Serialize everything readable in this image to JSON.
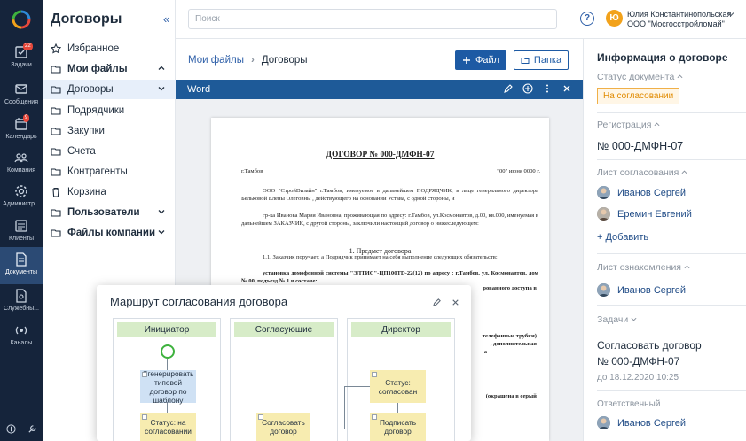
{
  "rail": {
    "items": [
      {
        "label": "Задачи",
        "icon": "tasks-icon",
        "badge": "22"
      },
      {
        "label": "Сообщения",
        "icon": "messages-icon",
        "badge": ""
      },
      {
        "label": "Календарь",
        "icon": "calendar-icon",
        "badge": "9"
      },
      {
        "label": "Компания",
        "icon": "company-icon",
        "badge": ""
      },
      {
        "label": "Администр...",
        "icon": "admin-gear-icon",
        "badge": ""
      },
      {
        "label": "Клиенты",
        "icon": "clients-icon",
        "badge": ""
      },
      {
        "label": "Документы",
        "icon": "documents-icon",
        "badge": "",
        "active": true
      },
      {
        "label": "Служебны...",
        "icon": "service-icon",
        "badge": ""
      },
      {
        "label": "Каналы",
        "icon": "channels-icon",
        "badge": ""
      }
    ]
  },
  "nav": {
    "title": "Договоры",
    "items": [
      {
        "label": "Избранное",
        "icon": "star-icon"
      },
      {
        "label": "Мои файлы",
        "icon": "folder-icon",
        "bold": true
      },
      {
        "label": "Договоры",
        "icon": "folder-icon",
        "active": true
      },
      {
        "label": "Подрядчики",
        "icon": "folder-icon"
      },
      {
        "label": "Закупки",
        "icon": "folder-icon"
      },
      {
        "label": "Счета",
        "icon": "folder-icon"
      },
      {
        "label": "Контрагенты",
        "icon": "folder-icon"
      },
      {
        "label": "Корзина",
        "icon": "trash-icon"
      },
      {
        "label": "Пользователи",
        "icon": "folder-icon",
        "bold": true
      },
      {
        "label": "Файлы компании",
        "icon": "folder-icon",
        "bold": true
      }
    ]
  },
  "topbar": {
    "search_placeholder": "Поиск",
    "help": "?",
    "avatar_letter": "Ю",
    "user_name": "Юлия Константинопольская",
    "org": "ООО \"Мосгосстройломай\""
  },
  "breadcrumbs": {
    "root": "Мои файлы",
    "current": "Договоры"
  },
  "toolbar": {
    "file_label": "Файл",
    "folder_label": "Папка"
  },
  "viewer": {
    "app": "Word"
  },
  "document": {
    "title": "ДОГОВОР № 000-ДМФН-07",
    "city": "г.Тамбов",
    "date": "\"00\" июня  0000 г.",
    "para1": "ООО \"СтройDизайн\" г.Тамбов, именуемое в дальнейшем ПОДРЯДЧИК, в лице генерального директора Бельковой Елены Олеговны , действующего на основании Устава, с одной стороны, и",
    "para2": "гр-ка Иванова Мария Ивановна, проживающая по адресу: г.Тамбов, ул.Космонавтов, д.00, кв.000, именуемая в дальнейшем ЗАКАЗЧИК, с другой стороны, заключили настоящий договор о нижеследующем:",
    "section": "1. Предмет договора",
    "para3": "1.1. Заказчик поручает, а Подрядчик принимает на себя выполнение следующих обязательств:",
    "para4": "установка домофонной системы \"ЭЛТИС\"-ЦП100TD-22(12) по адресу : г.Тамбов, ул. Космонавтов, дом № 00, подъезд № 1 в составе:",
    "frag1": "рованного доступа в",
    "frag2": "телефонные трубки)",
    "frag3": ", дополнительная",
    "frag4": "а",
    "frag5": "(окрашена в серый"
  },
  "route_modal": {
    "title": "Маршрут согласования договора",
    "lanes": [
      "Инициатор",
      "Согласующие",
      "Директор"
    ],
    "steps": {
      "generate": "Сгенерировать типовой договор по шаблону",
      "status_approval": "Статус: на согласовании",
      "approve": "Согласовать договор",
      "status_approved": "Статус: согласован",
      "sign": "Подписать договор"
    }
  },
  "info_panel": {
    "title": "Информация о договоре",
    "status_label": "Статус документа",
    "status_value": "На согласовании",
    "registration_label": "Регистрация",
    "registration_value": "№ 000-ДМФН-07",
    "approval_label": "Лист согласования",
    "approvers": [
      "Иванов Сергей",
      "Еремин Евгений"
    ],
    "add_label": "+ Добавить",
    "review_label": "Лист ознакомления",
    "reviewers": [
      "Иванов Сергей"
    ],
    "tasks_label": "Задачи",
    "task_title": "Согласовать договор",
    "task_number": "№ 000-ДМФН-07",
    "task_due": "до 18.12.2020  10:25",
    "responsible_label": "Ответственный",
    "responsible": "Иванов Сергей"
  },
  "colors": {
    "rail_bg": "#15243b",
    "accent": "#1d5aa4",
    "word_bar": "#1e5a98",
    "status_orange": "#e08a00"
  }
}
